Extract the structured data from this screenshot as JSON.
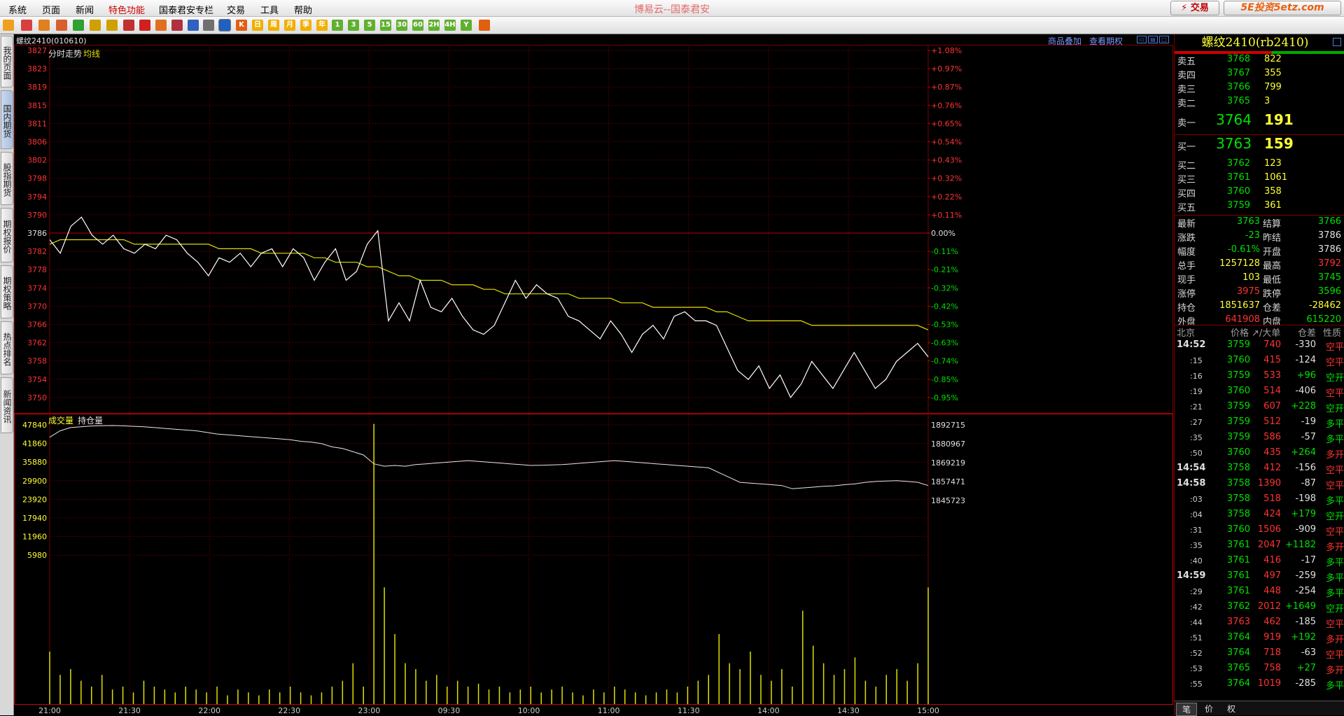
{
  "app_title": "博易云--国泰君安",
  "menu": [
    "系统",
    "页面",
    "新闻",
    "特色功能",
    "国泰君安专栏",
    "交易",
    "工具",
    "帮助"
  ],
  "menu_active_index": 3,
  "trade_button": "⚡ 交易",
  "watermark": "5E投资5etz.com",
  "toolbar_icons": [
    "back-arrow-icon",
    "home-icon",
    "book-icon",
    "layers-icon",
    "refresh-icon",
    "zoom-in-icon",
    "zoom-out-icon",
    "tile-icon",
    "pen-icon",
    "fire-icon",
    "filter-icon",
    "bookmark-icon",
    "table-icon",
    "intraday-chart-icon",
    "kline-icon",
    "day-icon",
    "week-icon",
    "month-icon",
    "quarter-icon",
    "year-icon",
    "min1-icon",
    "min3-icon",
    "min5-icon",
    "min15-icon",
    "min30-icon",
    "min60-icon",
    "hour2-icon",
    "hour4-icon",
    "custom-period-icon",
    "calc-icon"
  ],
  "toolbar_labels": [
    "",
    "",
    "",
    "",
    "",
    "",
    "",
    "",
    "",
    "",
    "",
    "",
    "",
    "",
    "K",
    "日",
    "周",
    "月",
    "季",
    "年",
    "1",
    "3",
    "5",
    "15",
    "30",
    "60",
    "2H",
    "4H",
    "Y",
    ""
  ],
  "side_tabs": [
    "我的页面",
    "国内期货",
    "股指期货",
    "期权报价",
    "期权策略",
    "热点排名",
    "新闻资讯"
  ],
  "side_active_index": 1,
  "chart_header": {
    "symbol": "螺纹2410(010610)",
    "link1": "商品叠加",
    "link2": "查看期权"
  },
  "chart_data": {
    "type": "line",
    "price_panel": {
      "labels": [
        "分时走势",
        "均线"
      ],
      "y_ticks": [
        3827,
        3823,
        3819,
        3815,
        3811,
        3806,
        3802,
        3798,
        3794,
        3790,
        3786,
        3782,
        3778,
        3774,
        3770,
        3766,
        3762,
        3758,
        3754,
        3750
      ],
      "pct_ticks": [
        "+1.08%",
        "+0.97%",
        "+0.87%",
        "+0.76%",
        "+0.65%",
        "+0.54%",
        "+0.43%",
        "+0.32%",
        "+0.22%",
        "+0.11%",
        "0.00%",
        "-0.11%",
        "-0.21%",
        "-0.32%",
        "-0.42%",
        "-0.53%",
        "-0.63%",
        "-0.74%",
        "-0.85%",
        "-0.95%"
      ],
      "prev_settle": 3786,
      "ylim": [
        3748,
        3828
      ],
      "price": [
        3785,
        3782,
        3788,
        3790,
        3786,
        3784,
        3786,
        3783,
        3782,
        3784,
        3783,
        3786,
        3785,
        3782,
        3780,
        3777,
        3781,
        3780,
        3782,
        3779,
        3782,
        3783,
        3779,
        3783,
        3781,
        3776,
        3780,
        3783,
        3776,
        3778,
        3784,
        3787,
        3767,
        3771,
        3767,
        3776,
        3770,
        3769,
        3772,
        3768,
        3765,
        3764,
        3766,
        3771,
        3776,
        3772,
        3775,
        3773,
        3772,
        3768,
        3767,
        3765,
        3763,
        3767,
        3764,
        3760,
        3764,
        3766,
        3763,
        3768,
        3769,
        3767,
        3767,
        3766,
        3761,
        3756,
        3754,
        3757,
        3752,
        3755,
        3750,
        3753,
        3758,
        3755,
        3752,
        3756,
        3760,
        3756,
        3752,
        3754,
        3758,
        3760,
        3762,
        3759
      ],
      "avg": [
        3784,
        3785,
        3785,
        3785,
        3785,
        3785,
        3785,
        3785,
        3784,
        3784,
        3784,
        3784,
        3784,
        3784,
        3784,
        3784,
        3783,
        3783,
        3783,
        3783,
        3782,
        3782,
        3782,
        3782,
        3782,
        3781,
        3781,
        3780,
        3780,
        3780,
        3779,
        3779,
        3778,
        3777,
        3777,
        3776,
        3776,
        3776,
        3775,
        3775,
        3775,
        3774,
        3774,
        3773,
        3773,
        3773,
        3773,
        3773,
        3773,
        3773,
        3772,
        3772,
        3772,
        3772,
        3771,
        3771,
        3771,
        3770,
        3770,
        3770,
        3770,
        3770,
        3770,
        3769,
        3769,
        3768,
        3767,
        3767,
        3767,
        3767,
        3767,
        3767,
        3766,
        3766,
        3766,
        3766,
        3766,
        3766,
        3766,
        3766,
        3766,
        3766,
        3766,
        3765
      ]
    },
    "volume_panel": {
      "labels": [
        "成交量",
        "持仓量"
      ],
      "vol_ticks": [
        47840,
        41860,
        35880,
        29900,
        23920,
        17940,
        11960,
        5980
      ],
      "oi_ticks": [
        1892715,
        1880967,
        1869219,
        1857471,
        1845723
      ],
      "vol_max": 49000,
      "oi_range": [
        1834000,
        1898000
      ],
      "open_interest": [
        1885000,
        1889000,
        1891000,
        1891500,
        1892000,
        1892200,
        1892300,
        1892100,
        1891800,
        1891500,
        1891000,
        1890500,
        1890000,
        1889500,
        1889000,
        1888000,
        1887000,
        1886500,
        1886000,
        1885500,
        1885000,
        1884500,
        1884000,
        1883500,
        1882500,
        1882000,
        1881000,
        1879000,
        1878000,
        1876000,
        1874000,
        1868500,
        1867000,
        1867500,
        1867000,
        1868000,
        1868500,
        1869000,
        1869500,
        1870000,
        1870500,
        1870000,
        1869500,
        1869000,
        1868500,
        1868000,
        1867500,
        1867600,
        1867800,
        1868000,
        1868500,
        1869000,
        1869500,
        1870000,
        1870500,
        1870000,
        1869500,
        1869000,
        1868500,
        1868000,
        1867500,
        1867000,
        1866500,
        1866000,
        1863000,
        1860000,
        1857000,
        1856500,
        1856000,
        1855500,
        1855000,
        1853000,
        1853500,
        1854000,
        1854500,
        1854800,
        1855500,
        1856000,
        1857000,
        1857500,
        1857800,
        1858000,
        1857500,
        1857000,
        1855000
      ],
      "volume": [
        9000,
        5000,
        6000,
        4000,
        3000,
        5000,
        2500,
        3000,
        2000,
        4000,
        3000,
        2500,
        2000,
        3000,
        2500,
        2000,
        3000,
        1500,
        2500,
        2000,
        1500,
        2500,
        2000,
        3000,
        2000,
        1500,
        2000,
        3000,
        4000,
        7000,
        3000,
        48000,
        20000,
        12000,
        7000,
        6000,
        4000,
        5000,
        3000,
        4000,
        3000,
        3500,
        2500,
        3000,
        2000,
        2500,
        3000,
        2000,
        2500,
        3000,
        2000,
        1500,
        2500,
        2000,
        3000,
        2500,
        2000,
        1500,
        2000,
        2500,
        2000,
        3000,
        4000,
        5000,
        12000,
        7000,
        6000,
        9000,
        5000,
        4000,
        6000,
        3000,
        16000,
        10000,
        7000,
        5000,
        6000,
        8000,
        4000,
        3000,
        5000,
        6000,
        4000,
        7000,
        20000
      ]
    },
    "x_ticks": [
      "21:00",
      "21:30",
      "22:00",
      "22:30",
      "23:00",
      "09:30",
      "10:00",
      "11:00",
      "11:30",
      "14:00",
      "14:30",
      "15:00"
    ]
  },
  "quote_panel": {
    "title": "螺纹2410(rb2410)",
    "asks": [
      {
        "label": "卖五",
        "price": "3768",
        "vol": "822"
      },
      {
        "label": "卖四",
        "price": "3767",
        "vol": "355"
      },
      {
        "label": "卖三",
        "price": "3766",
        "vol": "799"
      },
      {
        "label": "卖二",
        "price": "3765",
        "vol": "3"
      },
      {
        "label": "卖一",
        "price": "3764",
        "vol": "191"
      }
    ],
    "bids": [
      {
        "label": "买一",
        "price": "3763",
        "vol": "159"
      },
      {
        "label": "买二",
        "price": "3762",
        "vol": "123"
      },
      {
        "label": "买三",
        "price": "3761",
        "vol": "1061"
      },
      {
        "label": "买四",
        "price": "3760",
        "vol": "358"
      },
      {
        "label": "买五",
        "price": "3759",
        "vol": "361"
      }
    ],
    "stats": [
      {
        "l1": "最新",
        "v1": "3763",
        "c1": "green",
        "l2": "结算",
        "v2": "3766",
        "c2": "green"
      },
      {
        "l1": "涨跌",
        "v1": "-23",
        "c1": "green",
        "l2": "昨结",
        "v2": "3786",
        "c2": "white"
      },
      {
        "l1": "幅度",
        "v1": "-0.61%",
        "c1": "green",
        "l2": "开盘",
        "v2": "3786",
        "c2": "white"
      },
      {
        "l1": "总手",
        "v1": "1257128",
        "c1": "yellow",
        "l2": "最高",
        "v2": "3792",
        "c2": "red"
      },
      {
        "l1": "现手",
        "v1": "103",
        "c1": "yellow",
        "l2": "最低",
        "v2": "3745",
        "c2": "green"
      },
      {
        "l1": "涨停",
        "v1": "3975",
        "c1": "red",
        "l2": "跌停",
        "v2": "3596",
        "c2": "green"
      },
      {
        "l1": "持仓",
        "v1": "1851637",
        "c1": "yellow",
        "l2": "仓差",
        "v2": "-28462",
        "c2": "yellow"
      },
      {
        "l1": "外盘",
        "v1": "641908",
        "c1": "red",
        "l2": "内盘",
        "v2": "615220",
        "c2": "green"
      }
    ],
    "tick_header": {
      "time": "北京",
      "price": "价格",
      "vol": "↗/大单",
      "oi": "仓差",
      "nature": "性质"
    },
    "ticks": [
      {
        "t": "14:52",
        "main": true,
        "p": "3759",
        "pc": "green",
        "v": "740",
        "oi": "-330",
        "n": "空平",
        "nc": "red"
      },
      {
        "t": ":15",
        "main": false,
        "p": "3760",
        "pc": "green",
        "v": "415",
        "oi": "-124",
        "n": "空平",
        "nc": "red"
      },
      {
        "t": ":16",
        "main": false,
        "p": "3759",
        "pc": "green",
        "v": "533",
        "oi": "+96",
        "n": "空开",
        "nc": "green"
      },
      {
        "t": ":19",
        "main": false,
        "p": "3760",
        "pc": "green",
        "v": "514",
        "oi": "-406",
        "n": "空平",
        "nc": "red"
      },
      {
        "t": ":21",
        "main": false,
        "p": "3759",
        "pc": "green",
        "v": "607",
        "oi": "+228",
        "n": "空开",
        "nc": "green"
      },
      {
        "t": ":27",
        "main": false,
        "p": "3759",
        "pc": "green",
        "v": "512",
        "oi": "-19",
        "n": "多平",
        "nc": "green"
      },
      {
        "t": ":35",
        "main": false,
        "p": "3759",
        "pc": "green",
        "v": "586",
        "oi": "-57",
        "n": "多平",
        "nc": "green"
      },
      {
        "t": ":50",
        "main": false,
        "p": "3760",
        "pc": "green",
        "v": "435",
        "oi": "+264",
        "n": "多开",
        "nc": "red"
      },
      {
        "t": "14:54",
        "main": true,
        "p": "3758",
        "pc": "green",
        "v": "412",
        "oi": "-156",
        "n": "空平",
        "nc": "red"
      },
      {
        "t": "14:58",
        "main": true,
        "p": "3758",
        "pc": "green",
        "v": "1390",
        "oi": "-87",
        "n": "空平",
        "nc": "red"
      },
      {
        "t": ":03",
        "main": false,
        "p": "3758",
        "pc": "green",
        "v": "518",
        "oi": "-198",
        "n": "多平",
        "nc": "green"
      },
      {
        "t": ":04",
        "main": false,
        "p": "3758",
        "pc": "green",
        "v": "424",
        "oi": "+179",
        "n": "空开",
        "nc": "green"
      },
      {
        "t": ":31",
        "main": false,
        "p": "3760",
        "pc": "green",
        "v": "1506",
        "oi": "-909",
        "n": "空平",
        "nc": "red"
      },
      {
        "t": ":35",
        "main": false,
        "p": "3761",
        "pc": "green",
        "v": "2047",
        "oi": "+1182",
        "n": "多开",
        "nc": "red"
      },
      {
        "t": ":40",
        "main": false,
        "p": "3761",
        "pc": "green",
        "v": "416",
        "oi": "-17",
        "n": "多平",
        "nc": "green"
      },
      {
        "t": "14:59",
        "main": true,
        "p": "3761",
        "pc": "green",
        "v": "497",
        "oi": "-259",
        "n": "多平",
        "nc": "green"
      },
      {
        "t": ":29",
        "main": false,
        "p": "3761",
        "pc": "green",
        "v": "448",
        "oi": "-254",
        "n": "多平",
        "nc": "green"
      },
      {
        "t": ":42",
        "main": false,
        "p": "3762",
        "pc": "green",
        "v": "2012",
        "oi": "+1649",
        "n": "空开",
        "nc": "green"
      },
      {
        "t": ":44",
        "main": false,
        "p": "3763",
        "pc": "red",
        "v": "462",
        "oi": "-185",
        "n": "空平",
        "nc": "red"
      },
      {
        "t": ":51",
        "main": false,
        "p": "3764",
        "pc": "green",
        "v": "919",
        "oi": "+192",
        "n": "多开",
        "nc": "red"
      },
      {
        "t": ":52",
        "main": false,
        "p": "3764",
        "pc": "green",
        "v": "718",
        "oi": "-63",
        "n": "空平",
        "nc": "red"
      },
      {
        "t": ":53",
        "main": false,
        "p": "3765",
        "pc": "green",
        "v": "758",
        "oi": "+27",
        "n": "多开",
        "nc": "red"
      },
      {
        "t": ":55",
        "main": false,
        "p": "3764",
        "pc": "green",
        "v": "1019",
        "oi": "-285",
        "n": "多平",
        "nc": "green"
      }
    ],
    "bottom_tabs": [
      "笔",
      "价",
      "权"
    ]
  },
  "colors": {
    "grid": "#7a0000",
    "price_line": "#ffffff",
    "avg_line": "#e0e000",
    "volume_bar": "#e0e000",
    "red": "#ff3333",
    "green": "#00e000"
  }
}
